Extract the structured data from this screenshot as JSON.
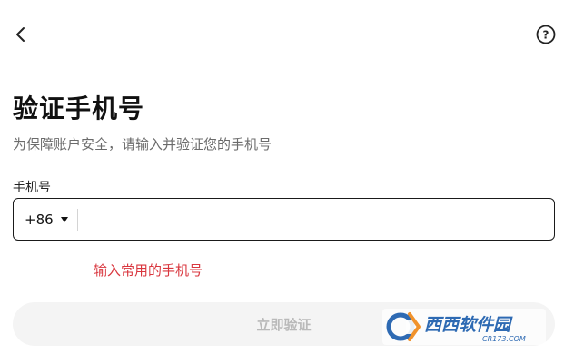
{
  "header": {
    "back_icon": "chevron-left-icon",
    "help_icon": "question-circle-icon",
    "help_glyph": "?"
  },
  "title": "验证手机号",
  "subtitle": "为保障账户安全，请输入并验证您的手机号",
  "phone_field": {
    "label": "手机号",
    "country_code": "+86",
    "value": "",
    "placeholder": ""
  },
  "hint": "输入常用的手机号",
  "verify_button": {
    "label": "立即验证"
  },
  "watermark": {
    "brand": "西西软件园",
    "url": "CR173.COM"
  },
  "colors": {
    "hint": "#d9363e",
    "button_bg": "#f4f4f4",
    "button_text": "#b9b9b9",
    "border": "#1a1a1a",
    "watermark_blue": "#1e5fae",
    "watermark_orange": "#f08a1c"
  }
}
